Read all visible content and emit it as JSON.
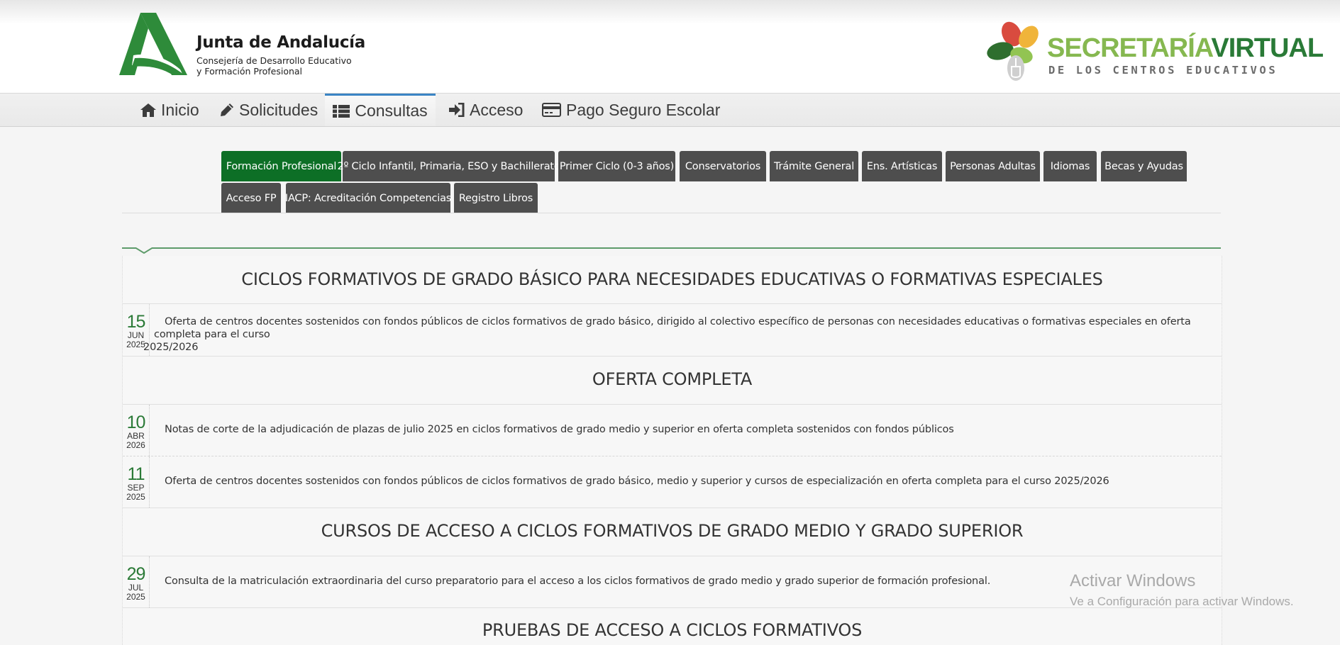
{
  "header": {
    "org_title": "Junta de Andalucía",
    "org_subtitle_line1": "Consejería de Desarrollo Educativo",
    "org_subtitle_line2": "y Formación Profesional",
    "brand_part1": "SECRETARÍA",
    "brand_part2": "VIRTUAL",
    "brand_subtitle": "DE LOS CENTROS EDUCATIVOS"
  },
  "nav": {
    "items": [
      {
        "label": "Inicio",
        "icon": "home-icon"
      },
      {
        "label": "Solicitudes",
        "icon": "pencil-icon"
      },
      {
        "label": "Consultas",
        "icon": "list-icon",
        "active": true
      },
      {
        "label": "Acceso",
        "icon": "sign-in-icon"
      },
      {
        "label": "Pago Seguro Escolar",
        "icon": "credit-card-icon"
      }
    ]
  },
  "tabs": [
    {
      "label": "Formación Profesional",
      "active": true
    },
    {
      "label": "2º Ciclo Infantil, Primaria, ESO y Bachillerato"
    },
    {
      "label": "Primer Ciclo (0-3 años)"
    },
    {
      "label": "Conservatorios"
    },
    {
      "label": "Trámite General"
    },
    {
      "label": "Ens. Artísticas"
    },
    {
      "label": "Personas Adultas"
    },
    {
      "label": "Idiomas"
    },
    {
      "label": "Becas y Ayudas"
    },
    {
      "label": "Acceso FP"
    },
    {
      "label": "IACP: Acreditación Competencias"
    },
    {
      "label": "Registro Libros"
    }
  ],
  "sections": [
    {
      "title": "CICLOS FORMATIVOS DE GRADO BÁSICO PARA NECESIDADES EDUCATIVAS O FORMATIVAS ESPECIALES",
      "entries": [
        {
          "day": "15",
          "month": "JUN",
          "year": "2025",
          "text_line1": "Oferta de centros docentes sostenidos con fondos públicos de ciclos formativos de grado básico, dirigido al colectivo específico de personas con necesidades educativas o formativas especiales en oferta completa para el curso",
          "text_line2": "2025/2026"
        }
      ]
    },
    {
      "title": "OFERTA COMPLETA",
      "entries": [
        {
          "day": "10",
          "month": "ABR",
          "year": "2026",
          "text_line1": "Notas de corte de la adjudicación de plazas de julio 2025 en ciclos formativos de grado medio y superior en oferta completa sostenidos con fondos públicos"
        },
        {
          "day": "11",
          "month": "SEP",
          "year": "2025",
          "text_line1": "Oferta de centros docentes sostenidos con fondos públicos de ciclos formativos de grado básico, medio y superior y cursos de especialización en oferta completa para el curso 2025/2026"
        }
      ]
    },
    {
      "title": "CURSOS DE ACCESO A CICLOS FORMATIVOS DE GRADO MEDIO Y GRADO SUPERIOR",
      "entries": [
        {
          "day": "29",
          "month": "JUL",
          "year": "2025",
          "text_line1": "Consulta de la matriculación extraordinaria del curso preparatorio para el acceso a los ciclos formativos de grado medio y grado superior de formación profesional."
        }
      ]
    },
    {
      "title": "PRUEBAS DE ACCESO A CICLOS FORMATIVOS",
      "entries": []
    }
  ],
  "watermark": {
    "line1": "Activar Windows",
    "line2": "Ve a Configuración para activar Windows."
  },
  "colors": {
    "active_tab": "#0d6f26",
    "tab": "#4e4e4e",
    "date_green": "#2b7a37",
    "nav_active_border": "#3a84c4"
  }
}
